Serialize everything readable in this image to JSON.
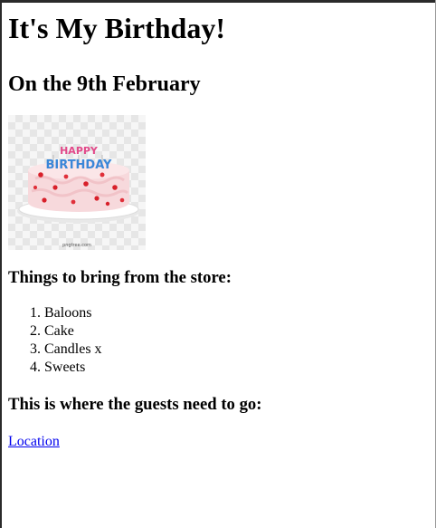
{
  "page": {
    "title": "It's My Birthday!",
    "subtitle": "On the 9th February"
  },
  "image": {
    "topper_line1": "HAPPY",
    "topper_line2": "BIRTHDAY",
    "watermark": "pngtree.com"
  },
  "shopping": {
    "heading": "Things to bring from the store:",
    "items": [
      "Baloons",
      "Cake",
      "Candles x",
      "Sweets"
    ]
  },
  "guests": {
    "heading": "This is where the guests need to go:",
    "link_label": "Location"
  }
}
